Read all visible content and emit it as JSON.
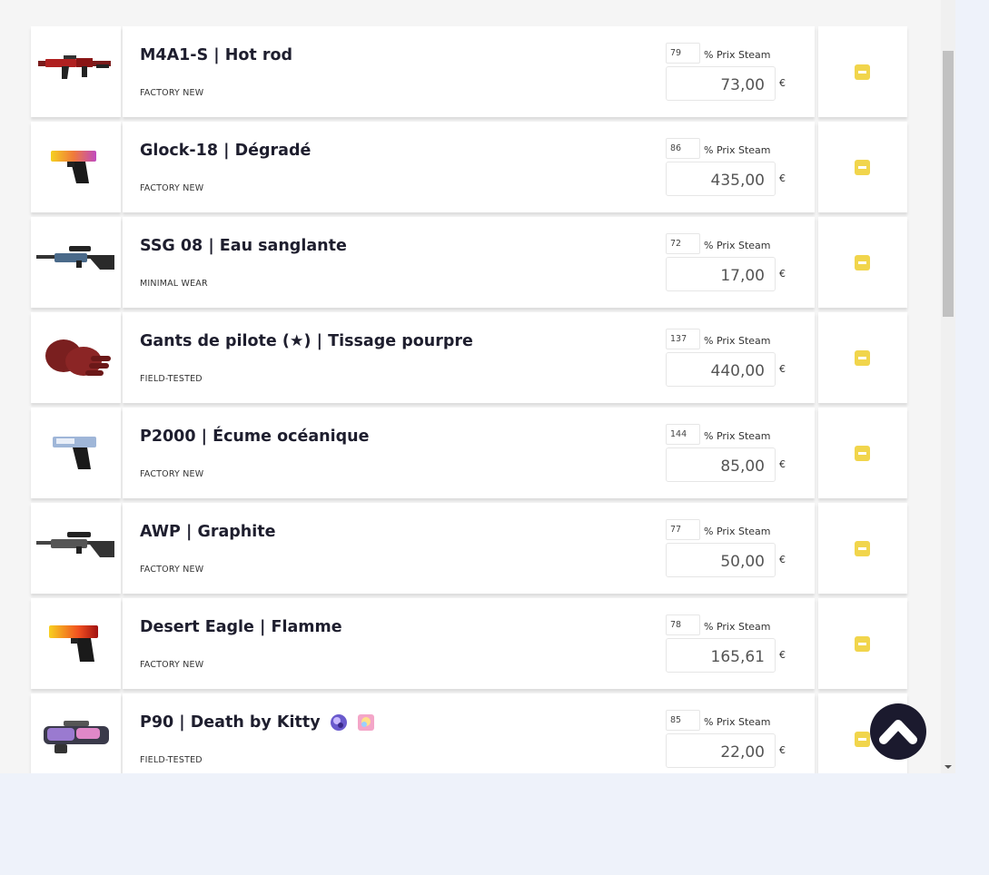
{
  "inventory": {
    "pct_label": "% Prix Steam",
    "currency": "€",
    "items": [
      {
        "name": "M4A1-S | Hot rod",
        "wear": "FACTORY NEW",
        "pct": "79",
        "price": "73,00",
        "stickers": []
      },
      {
        "name": "Glock-18 | Dégradé",
        "wear": "FACTORY NEW",
        "pct": "86",
        "price": "435,00",
        "stickers": []
      },
      {
        "name": "SSG 08 | Eau sanglante",
        "wear": "MINIMAL WEAR",
        "pct": "72",
        "price": "17,00",
        "stickers": []
      },
      {
        "name": "Gants de pilote (★) | Tissage pourpre",
        "wear": "FIELD-TESTED",
        "pct": "137",
        "price": "440,00",
        "stickers": []
      },
      {
        "name": "P2000 | Écume océanique",
        "wear": "FACTORY NEW",
        "pct": "144",
        "price": "85,00",
        "stickers": []
      },
      {
        "name": "AWP | Graphite",
        "wear": "FACTORY NEW",
        "pct": "77",
        "price": "50,00",
        "stickers": []
      },
      {
        "name": "Desert Eagle | Flamme",
        "wear": "FACTORY NEW",
        "pct": "78",
        "price": "165,61",
        "stickers": []
      },
      {
        "name": "P90 | Death by Kitty",
        "wear": "FIELD-TESTED",
        "pct": "85",
        "price": "22,00",
        "stickers": [
          "purple-sticker-icon",
          "pink-sticker-icon"
        ]
      }
    ]
  },
  "colors": {
    "remove_button": "#f1d54c",
    "scroll_top_button": "#1b1a2e",
    "page_background": "#eef2fa"
  },
  "icons": {
    "remove": "minus-icon",
    "scroll_top": "chevron-up-icon"
  }
}
